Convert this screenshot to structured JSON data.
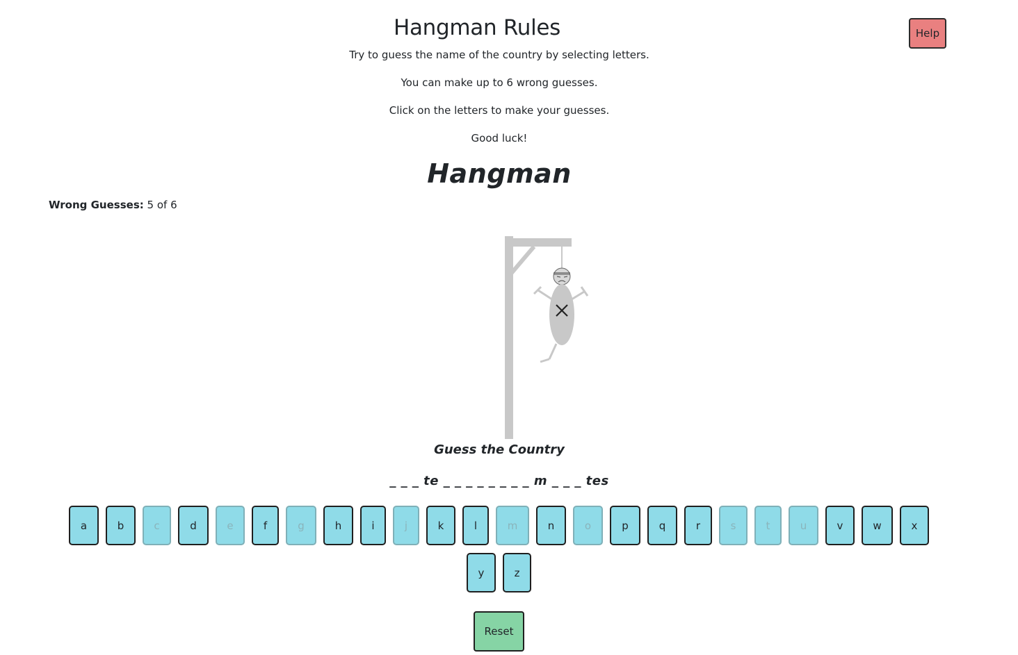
{
  "rules": {
    "title": "Hangman Rules",
    "lines": [
      "Try to guess the name of the country by selecting letters.",
      "You can make up to 6 wrong guesses.",
      "Click on the letters to make your guesses.",
      "Good luck!"
    ]
  },
  "help_label": "Help",
  "game": {
    "title": "Hangman",
    "wrong_label": "Wrong Guesses:",
    "wrong_value": "5 of 6",
    "wrong_count": 5,
    "max_wrong": 6,
    "subtitle": "Guess the Country",
    "word_display": "_ _ _ te _ _ _ _ _ _ _ _ m _ _ _ tes"
  },
  "keyboard": [
    {
      "letter": "a",
      "used": false
    },
    {
      "letter": "b",
      "used": false
    },
    {
      "letter": "c",
      "used": true
    },
    {
      "letter": "d",
      "used": false
    },
    {
      "letter": "e",
      "used": true
    },
    {
      "letter": "f",
      "used": false
    },
    {
      "letter": "g",
      "used": true
    },
    {
      "letter": "h",
      "used": false
    },
    {
      "letter": "i",
      "used": false
    },
    {
      "letter": "j",
      "used": true
    },
    {
      "letter": "k",
      "used": false
    },
    {
      "letter": "l",
      "used": false
    },
    {
      "letter": "m",
      "used": true
    },
    {
      "letter": "n",
      "used": false
    },
    {
      "letter": "o",
      "used": true
    },
    {
      "letter": "p",
      "used": false
    },
    {
      "letter": "q",
      "used": false
    },
    {
      "letter": "r",
      "used": false
    },
    {
      "letter": "s",
      "used": true
    },
    {
      "letter": "t",
      "used": true
    },
    {
      "letter": "u",
      "used": true
    },
    {
      "letter": "v",
      "used": false
    },
    {
      "letter": "w",
      "used": false
    },
    {
      "letter": "x",
      "used": false
    },
    {
      "letter": "y",
      "used": false
    },
    {
      "letter": "z",
      "used": false
    }
  ],
  "reset_label": "Reset",
  "colors": {
    "key_bg": "#8fdbe8",
    "help_bg": "#e98080",
    "reset_bg": "#86d4a5",
    "gallows": "#c8c8c8"
  }
}
